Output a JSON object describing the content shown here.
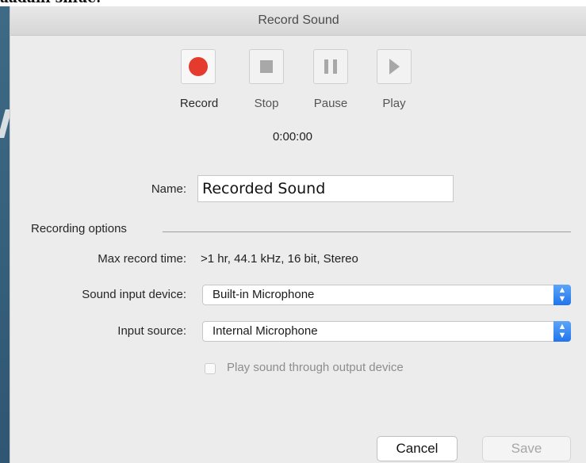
{
  "top_text": "aadani sniue.",
  "dialog": {
    "title": "Record Sound",
    "transport": {
      "record_label": "Record",
      "stop_label": "Stop",
      "pause_label": "Pause",
      "play_label": "Play",
      "time": "0:00:00"
    },
    "name": {
      "label": "Name:",
      "value": "Recorded Sound"
    },
    "options": {
      "section_label": "Recording options",
      "max_record_label": "Max record time:",
      "max_record_value": ">1 hr, 44.1 kHz, 16 bit, Stereo",
      "input_device_label": "Sound input device:",
      "input_device_value": "Built-in Microphone",
      "input_source_label": "Input source:",
      "input_source_value": "Internal Microphone",
      "playthrough_label": "Play sound through output device",
      "playthrough_checked": false
    },
    "buttons": {
      "cancel": "Cancel",
      "save": "Save"
    }
  },
  "colors": {
    "record": "#e53a2e",
    "select_accent": "#2174ec"
  }
}
